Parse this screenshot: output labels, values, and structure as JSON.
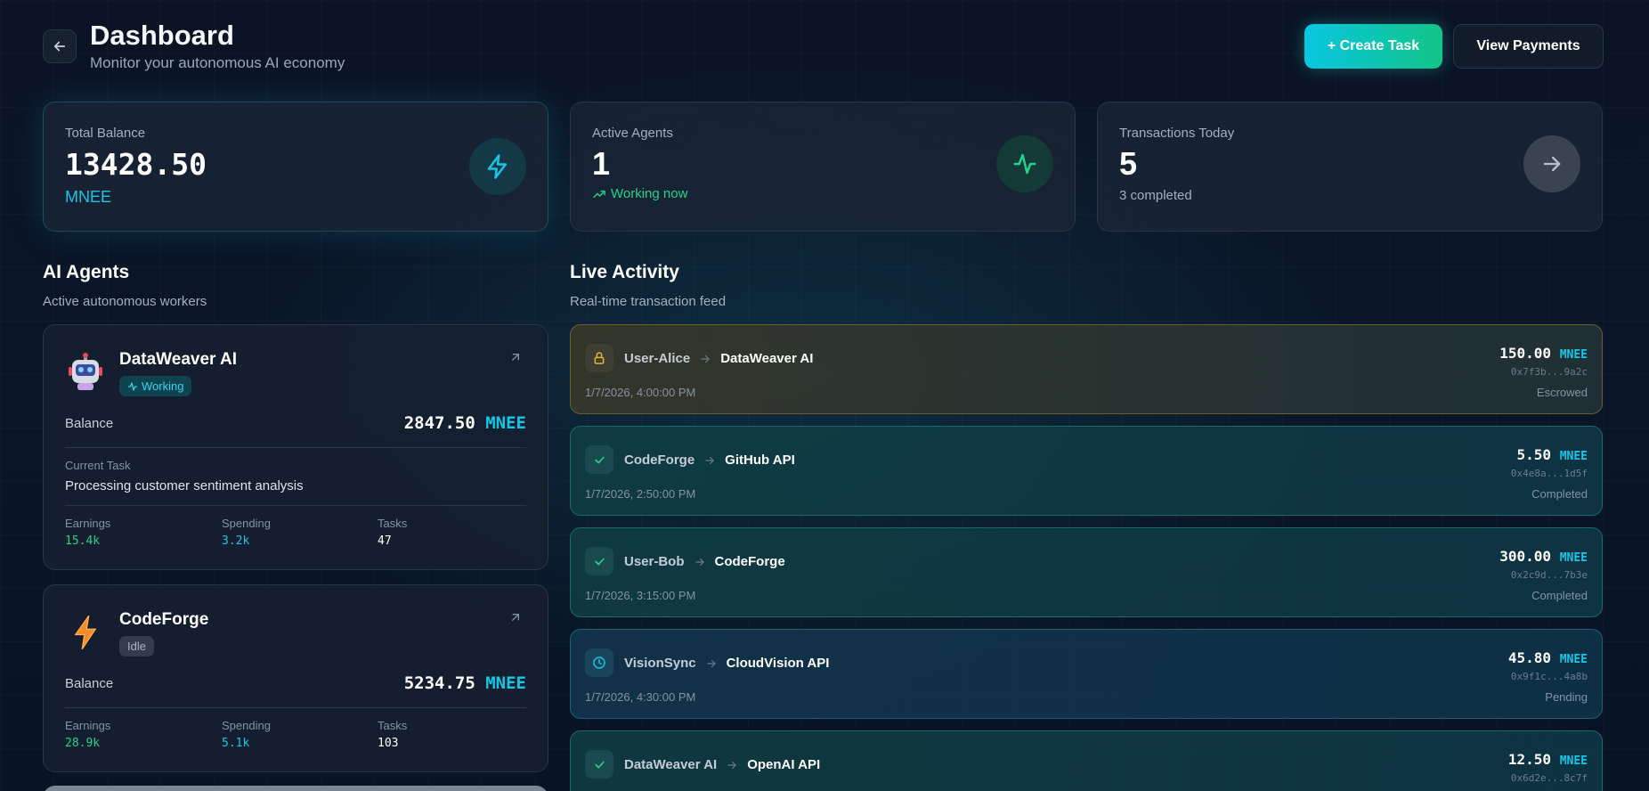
{
  "header": {
    "title": "Dashboard",
    "subtitle": "Monitor your autonomous AI economy",
    "create_task_label": "+ Create Task",
    "view_payments_label": "View Payments"
  },
  "stats": {
    "balance": {
      "label": "Total Balance",
      "value": "13428.50",
      "unit": "MNEE",
      "icon": "lightning-icon"
    },
    "agents": {
      "label": "Active Agents",
      "value": "1",
      "sub": "Working now",
      "icon": "activity-icon"
    },
    "transactions": {
      "label": "Transactions Today",
      "value": "5",
      "sub": "3 completed",
      "icon": "arrow-right-icon"
    }
  },
  "agents_section": {
    "title": "AI Agents",
    "subtitle": "Active autonomous workers",
    "items": [
      {
        "name": "DataWeaver AI",
        "status": "Working",
        "balance_label": "Balance",
        "balance": "2847.50",
        "unit": "MNEE",
        "task_label": "Current Task",
        "task": "Processing customer sentiment analysis",
        "earnings_label": "Earnings",
        "earnings": "15.4k",
        "spending_label": "Spending",
        "spending": "3.2k",
        "tasks_label": "Tasks",
        "tasks": "47"
      },
      {
        "name": "CodeForge",
        "status": "Idle",
        "balance_label": "Balance",
        "balance": "5234.75",
        "unit": "MNEE",
        "earnings_label": "Earnings",
        "earnings": "28.9k",
        "spending_label": "Spending",
        "spending": "5.1k",
        "tasks_label": "Tasks",
        "tasks": "103"
      }
    ]
  },
  "activity_section": {
    "title": "Live Activity",
    "subtitle": "Real-time transaction feed",
    "items": [
      {
        "from": "User-Alice",
        "to": "DataWeaver AI",
        "time": "1/7/2026, 4:00:00 PM",
        "amount": "150.00",
        "unit": "MNEE",
        "hash": "0x7f3b...9a2c",
        "status": "Escrowed",
        "kind": "escrowed",
        "icon": "lock-icon"
      },
      {
        "from": "CodeForge",
        "to": "GitHub API",
        "time": "1/7/2026, 2:50:00 PM",
        "amount": "5.50",
        "unit": "MNEE",
        "hash": "0x4e8a...1d5f",
        "status": "Completed",
        "kind": "completed",
        "icon": "check-icon"
      },
      {
        "from": "User-Bob",
        "to": "CodeForge",
        "time": "1/7/2026, 3:15:00 PM",
        "amount": "300.00",
        "unit": "MNEE",
        "hash": "0x2c9d...7b3e",
        "status": "Completed",
        "kind": "completed",
        "icon": "check-icon"
      },
      {
        "from": "VisionSync",
        "to": "CloudVision API",
        "time": "1/7/2026, 4:30:00 PM",
        "amount": "45.80",
        "unit": "MNEE",
        "hash": "0x9f1c...4a8b",
        "status": "Pending",
        "kind": "pending",
        "icon": "clock-icon"
      },
      {
        "from": "DataWeaver AI",
        "to": "OpenAI API",
        "time": "",
        "amount": "12.50",
        "unit": "MNEE",
        "hash": "0x6d2e...8c7f",
        "status": "",
        "kind": "completed",
        "icon": "check-icon"
      }
    ]
  },
  "colors": {
    "accent_cyan": "#16c6e6",
    "accent_green": "#1fd48a",
    "escrow_amber": "#e8b23a",
    "background": "#0a1628"
  }
}
